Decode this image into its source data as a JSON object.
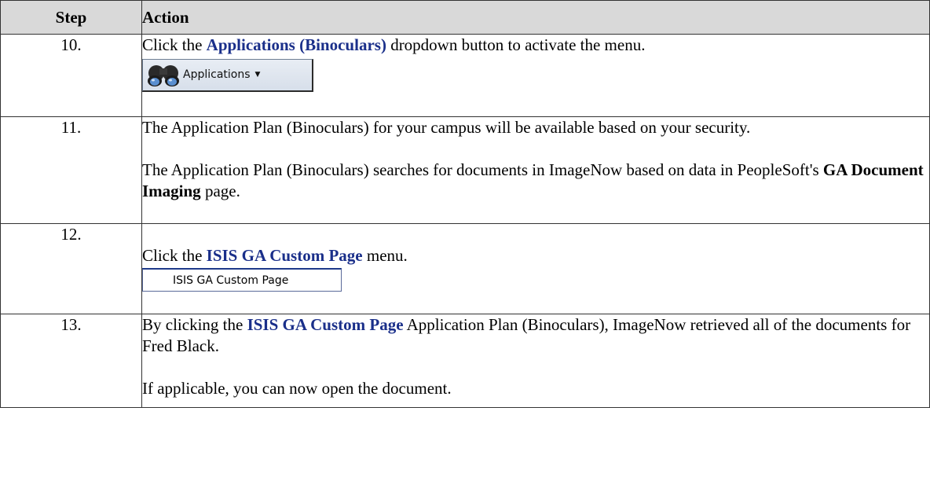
{
  "table": {
    "headers": {
      "step": "Step",
      "action": "Action"
    },
    "rows": [
      {
        "num": "10.",
        "text_pre": "Click the ",
        "link": "Applications (Binoculars)",
        "text_post": " dropdown button to activate the menu.",
        "button_label": "Applications",
        "button_icon": "binoculars-icon"
      },
      {
        "num": "11.",
        "p1": "The Application Plan (Binoculars) for your campus will be available based on your security.",
        "p2_pre": "The Application Plan (Binoculars) searches for documents in ImageNow based on data in PeopleSoft's ",
        "p2_bold": "GA Document Imaging",
        "p2_post": " page."
      },
      {
        "num": "12.",
        "text_pre": "Click the ",
        "link": "ISIS GA Custom Page",
        "text_post": " menu.",
        "menu_label": "ISIS GA Custom Page"
      },
      {
        "num": "13.",
        "p1_pre": "By clicking the ",
        "p1_link": "ISIS GA Custom Page",
        "p1_post": " Application Plan (Binoculars), ImageNow retrieved all of the documents for Fred Black.",
        "p2": "If applicable, you can now open the document."
      }
    ]
  },
  "colors": {
    "link": "#1a2f8a",
    "header_bg": "#d9d9d9",
    "border": "#333333"
  }
}
